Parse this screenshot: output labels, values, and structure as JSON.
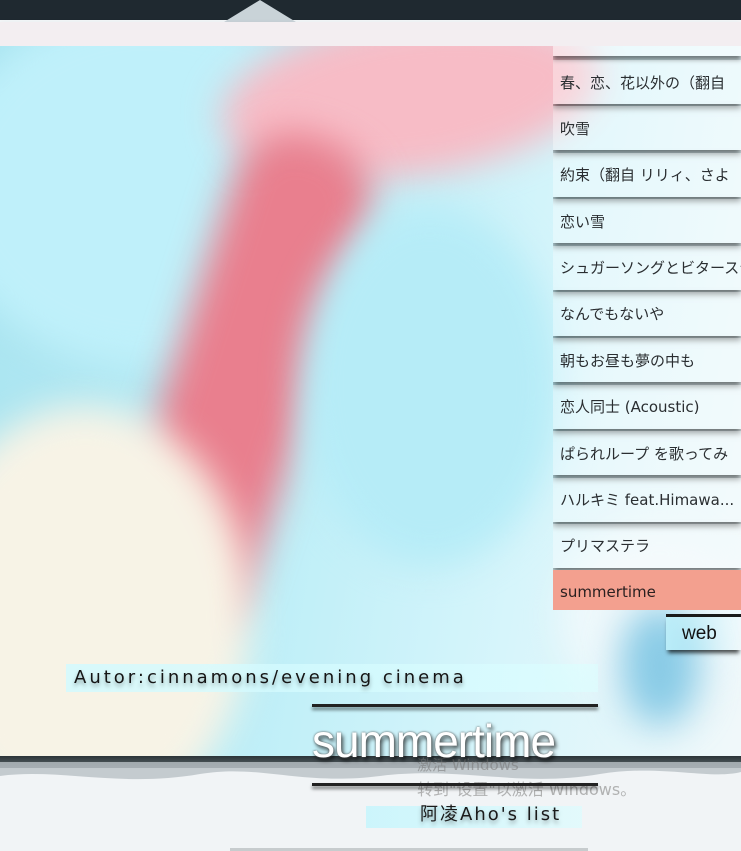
{
  "playlist": {
    "items": [
      {
        "label": "春、恋、花以外の（翻自"
      },
      {
        "label": "吹雪"
      },
      {
        "label": "約束（翻自 リリィ、さよ"
      },
      {
        "label": "恋い雪"
      },
      {
        "label": "シュガーソングとビターステ"
      },
      {
        "label": "なんでもないや"
      },
      {
        "label": "朝もお昼も夢の中も"
      },
      {
        "label": "恋人同士 (Acoustic)"
      },
      {
        "label": "ぱられループ を歌ってみ"
      },
      {
        "label": "ハルキミ feat.Himawa..."
      },
      {
        "label": "プリマステラ"
      },
      {
        "label": "summertime"
      }
    ],
    "active_index": 11
  },
  "web_button": {
    "label": "web"
  },
  "now_playing": {
    "author": "Autor:cinnamons/evening cinema",
    "title": "summertime",
    "list_name": "阿凌Aho's list"
  },
  "watermark": {
    "line1": "激活 Windows",
    "line2": "转到\"设置\"以激活 Windows。"
  },
  "colors": {
    "active_item": "#f3a08f",
    "topbar": "#1f2930",
    "sky": "#bceef7",
    "ribbon": "#e86a7c"
  }
}
